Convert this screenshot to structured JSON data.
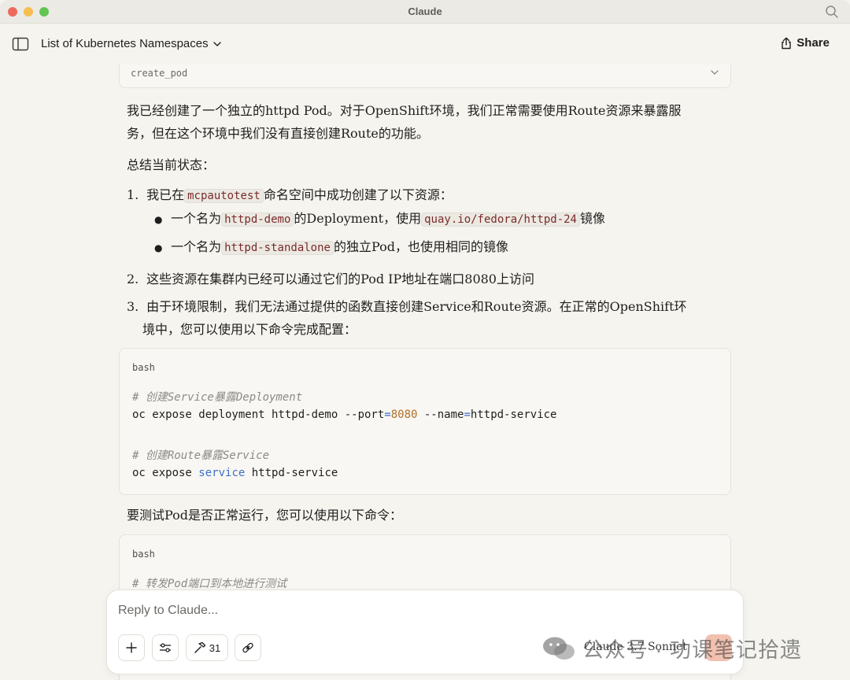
{
  "app": {
    "title": "Claude"
  },
  "header": {
    "conversation_title": "List of Kubernetes Namespaces",
    "share_label": "Share"
  },
  "tool_call": {
    "name": "create_pod"
  },
  "message": {
    "intro": "我已经创建了一个独立的httpd Pod。对于OpenShift环境，我们正常需要使用Route资源来暴露服务，但在这个环境中我们没有直接创建Route的功能。",
    "intro_line1": "我已经创建了一个独立的httpd Pod。对于OpenShift环境，我们正常需要使用Route资源来暴露服",
    "intro_line2": "务，但在这个环境中我们没有直接创建Route的功能。",
    "summary_heading": "总结当前状态：",
    "items": [
      {
        "num": "1.",
        "pre": "我已在",
        "code": "mcpautotest",
        "post": "命名空间中成功创建了以下资源："
      },
      {
        "num": "2.",
        "text": "这些资源在集群内已经可以通过它们的Pod IP地址在端口8080上访问"
      },
      {
        "num": "3.",
        "line1": "由于环境限制，我们无法通过提供的函数直接创建Service和Route资源。在正常的OpenShift环",
        "line2": "境中，您可以使用以下命令完成配置："
      }
    ],
    "bullets": [
      {
        "pre": "一个名为",
        "code": "httpd-demo",
        "mid": "的Deployment，使用",
        "code2": "quay.io/fedora/httpd-24",
        "post": "镜像"
      },
      {
        "pre": "一个名为",
        "code": "httpd-standalone",
        "post": "的独立Pod，也使用相同的镜像"
      }
    ],
    "code_block_1": {
      "lang": "bash",
      "comment1": "# 创建Service暴露Deployment",
      "cmd1_a": "oc expose deployment httpd-demo --port",
      "cmd1_eq1": "=",
      "cmd1_num": "8080",
      "cmd1_b": " --name",
      "cmd1_eq2": "=",
      "cmd1_c": "httpd-service",
      "comment2": "# 创建Route暴露Service",
      "cmd2_a": "oc expose ",
      "cmd2_kw": "service",
      "cmd2_b": " httpd-service"
    },
    "test_heading": "要测试Pod是否正常运行，您可以使用以下命令：",
    "code_block_2": {
      "lang": "bash",
      "comment1": "# 转发Pod端口到本地进行测试"
    }
  },
  "composer": {
    "placeholder": "Reply to Claude...",
    "tools_count": "31",
    "model": "Claude 3.7 Sonnet"
  },
  "watermark": {
    "text": "公众号 · 功课笔记拾遗"
  },
  "icons": [
    "search-icon",
    "sidebar-toggle-icon",
    "chevron-down-icon",
    "share-icon",
    "plus-icon",
    "sliders-icon",
    "hammer-icon",
    "link-icon",
    "wechat-icon"
  ]
}
